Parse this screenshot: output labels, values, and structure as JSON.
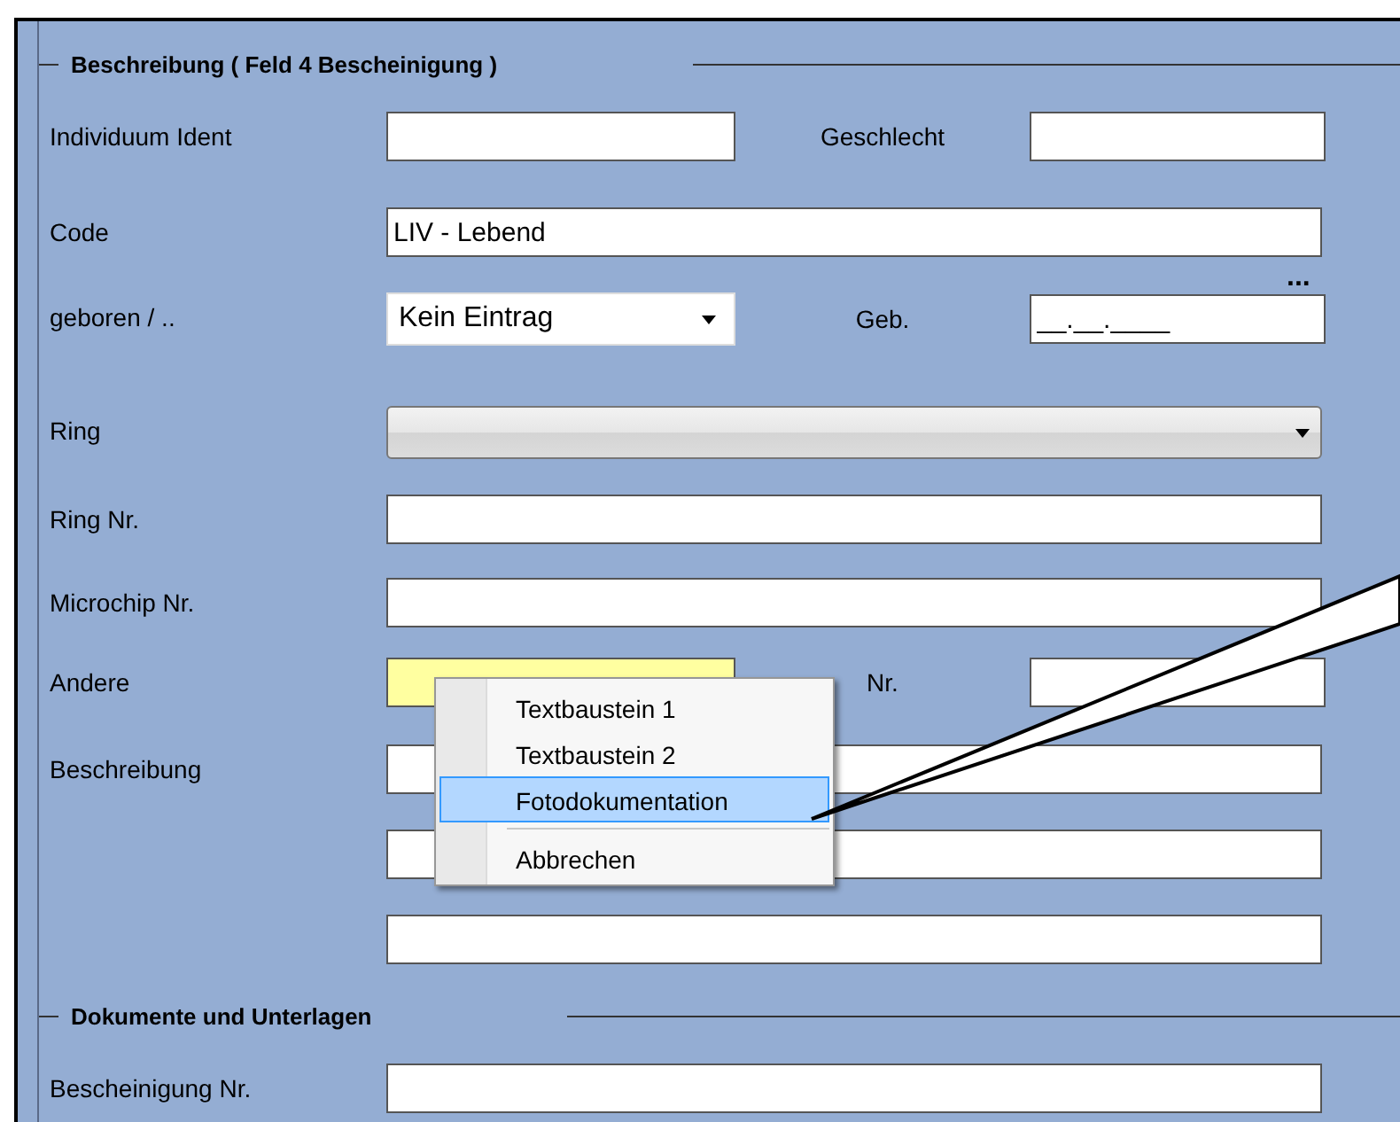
{
  "sections": [
    {
      "title": "Beschreibung ( Feld 4 Bescheinigung )",
      "rows": [
        {
          "label": "Individuum Ident",
          "fields": [
            {
              "kind": "text",
              "highlighted": false
            }
          ],
          "extra": {
            "label": "Geschlecht",
            "field": {
              "kind": "text",
              "highlighted": false
            }
          }
        },
        {
          "label": "Code",
          "fields": [
            {
              "kind": "text",
              "value": "LIV - Lebend",
              "highlighted": false
            }
          ],
          "more": "..."
        },
        {
          "label": "geboren / ..",
          "fields": [
            {
              "kind": "dropdown",
              "value": "Kein Eintrag"
            }
          ],
          "extra": {
            "label": "Geb.",
            "field": {
              "kind": "text",
              "value": "__.__.____",
              "highlighted": false
            }
          }
        },
        {
          "label": "Ring",
          "fields": [
            {
              "kind": "combo"
            }
          ]
        },
        {
          "label": "Ring Nr.",
          "fields": [
            {
              "kind": "text",
              "highlighted": false
            }
          ]
        },
        {
          "label": "Microchip Nr.",
          "fields": [
            {
              "kind": "text",
              "highlighted": false
            }
          ]
        },
        {
          "label": "Andere",
          "fields": [
            {
              "kind": "text",
              "highlighted": true
            }
          ],
          "extra": {
            "label": "Nr.",
            "field": {
              "kind": "text",
              "highlighted": false
            }
          }
        },
        {
          "label": "Beschreibung",
          "fields": [
            {
              "kind": "text",
              "highlighted": false
            },
            {
              "kind": "text",
              "highlighted": false
            },
            {
              "kind": "text",
              "highlighted": false
            }
          ]
        }
      ]
    },
    {
      "title": "Dokumente und Unterlagen",
      "rows": [
        {
          "label": "Bescheinigung Nr.",
          "fields": [
            {
              "kind": "text",
              "highlighted": false
            }
          ]
        }
      ]
    }
  ],
  "context_menu": [
    {
      "kind": "item",
      "label": "Textbaustein 1",
      "selected": false
    },
    {
      "kind": "item",
      "label": "Textbaustein 2",
      "selected": false
    },
    {
      "kind": "item",
      "label": "Fotodokumentation",
      "selected": true
    },
    {
      "kind": "separator"
    },
    {
      "kind": "item",
      "label": "Abbrechen",
      "selected": false
    }
  ]
}
